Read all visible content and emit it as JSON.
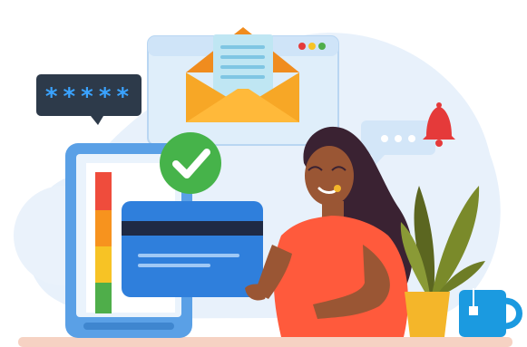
{
  "password_bubble": {
    "text": "*****"
  },
  "colors": {
    "background_blob": "#e8f1fb",
    "tablet_frame": "#5aa0e6",
    "tablet_screen": "#eaf3fc",
    "card_blue": "#2f7fdc",
    "card_stripe": "#1f2a44",
    "envelope": "#f7a726",
    "envelope_flap": "#f08c1e",
    "letter": "#bfe6f3",
    "browser_window": "#dfeefa",
    "check_green": "#46b34a",
    "bubble_dark": "#2d3a4a",
    "password_stars": "#3aa3ff",
    "bell_red": "#e53a3a",
    "shirt": "#ff5a3c",
    "skin": "#9a5634",
    "hair": "#3a2232",
    "plant_leaf": "#7a8a2a",
    "pot_yellow": "#f4b62a",
    "mug_blue": "#1b9ae0",
    "floor": "#f6d2c3",
    "meter_red": "#ef4c3c",
    "meter_orange": "#f7931e",
    "meter_yellow": "#f7c325",
    "meter_green": "#4fae4a"
  },
  "icons": {
    "check": "check-circle-icon",
    "envelope": "envelope-icon",
    "bell": "bell-icon",
    "password": "password-bubble-icon",
    "card": "credit-card-icon"
  }
}
